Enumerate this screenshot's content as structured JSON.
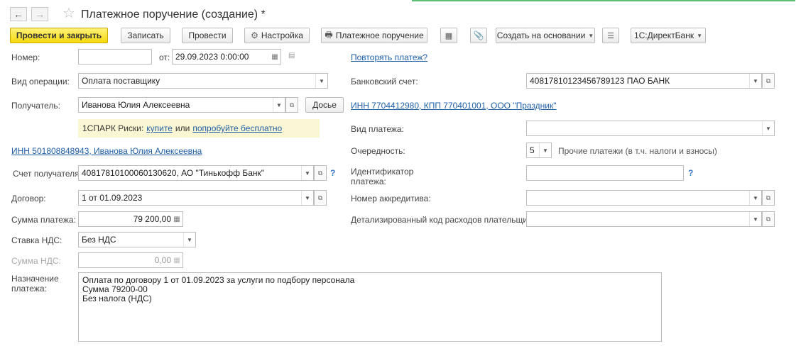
{
  "window": {
    "title": "Платежное поручение (создание) *"
  },
  "toolbar": {
    "post_close": "Провести и закрыть",
    "save": "Записать",
    "post": "Провести",
    "settings": "Настройка",
    "print_order": "Платежное поручение",
    "create_based": "Создать на основании",
    "direct_bank": "1С:ДиректБанк"
  },
  "form": {
    "number_label": "Номер:",
    "number_value": "",
    "date_prefix": "от:",
    "date_value": "29.09.2023  0:00:00",
    "repeat_payment_link": "Повторять платеж?",
    "operation_label": "Вид операции:",
    "operation_value": "Оплата поставщику",
    "bank_account_label": "Банковский счет:",
    "bank_account_value": "40817810123456789123 ПАО БАНК",
    "recipient_label": "Получатель:",
    "recipient_value": "Иванова Юлия Алексеевна",
    "dossier_button": "Досье",
    "recipient_inn_link": "ИНН 7704412980, КПП 770401001, ООО \"Праздник\"",
    "spark_prefix": "1СПАРК Риски:",
    "spark_buy": "купите",
    "spark_or": "или",
    "spark_try": "попробуйте бесплатно",
    "payment_type_label": "Вид платежа:",
    "payment_type_value": "",
    "person_inn_link": "ИНН 501808848943, Иванова Юлия Алексеевна",
    "priority_label": "Очередность:",
    "priority_value": "5",
    "priority_note": "Прочие платежи (в т.ч. налоги и взносы)",
    "recipient_account_label": "Счет получателя:",
    "recipient_account_value": "40817810100060130620, АО \"Тинькофф Банк\"",
    "payment_id_label_line1": "Идентификатор",
    "payment_id_label_line2": "платежа:",
    "payment_id_value": "",
    "contract_label": "Договор:",
    "contract_value": "1 от 01.09.2023",
    "letter_of_credit_label": "Номер аккредитива:",
    "letter_of_credit_value": "",
    "amount_label": "Сумма платежа:",
    "amount_value": "79 200,00",
    "expense_code_label": "Детализированный код расходов плательщика:",
    "expense_code_value": "",
    "vat_rate_label": "Ставка НДС:",
    "vat_rate_value": "Без НДС",
    "vat_amount_label": "Сумма НДС:",
    "vat_amount_value": "0,00",
    "purpose_label_line1": "Назначение",
    "purpose_label_line2": "платежа:",
    "purpose_lines": [
      "Оплата по договору 1 от 01.09.2023 за услуги по подбору персонала",
      "Сумма 79200-00",
      "Без налога (НДС)"
    ],
    "help_mark": "?"
  }
}
